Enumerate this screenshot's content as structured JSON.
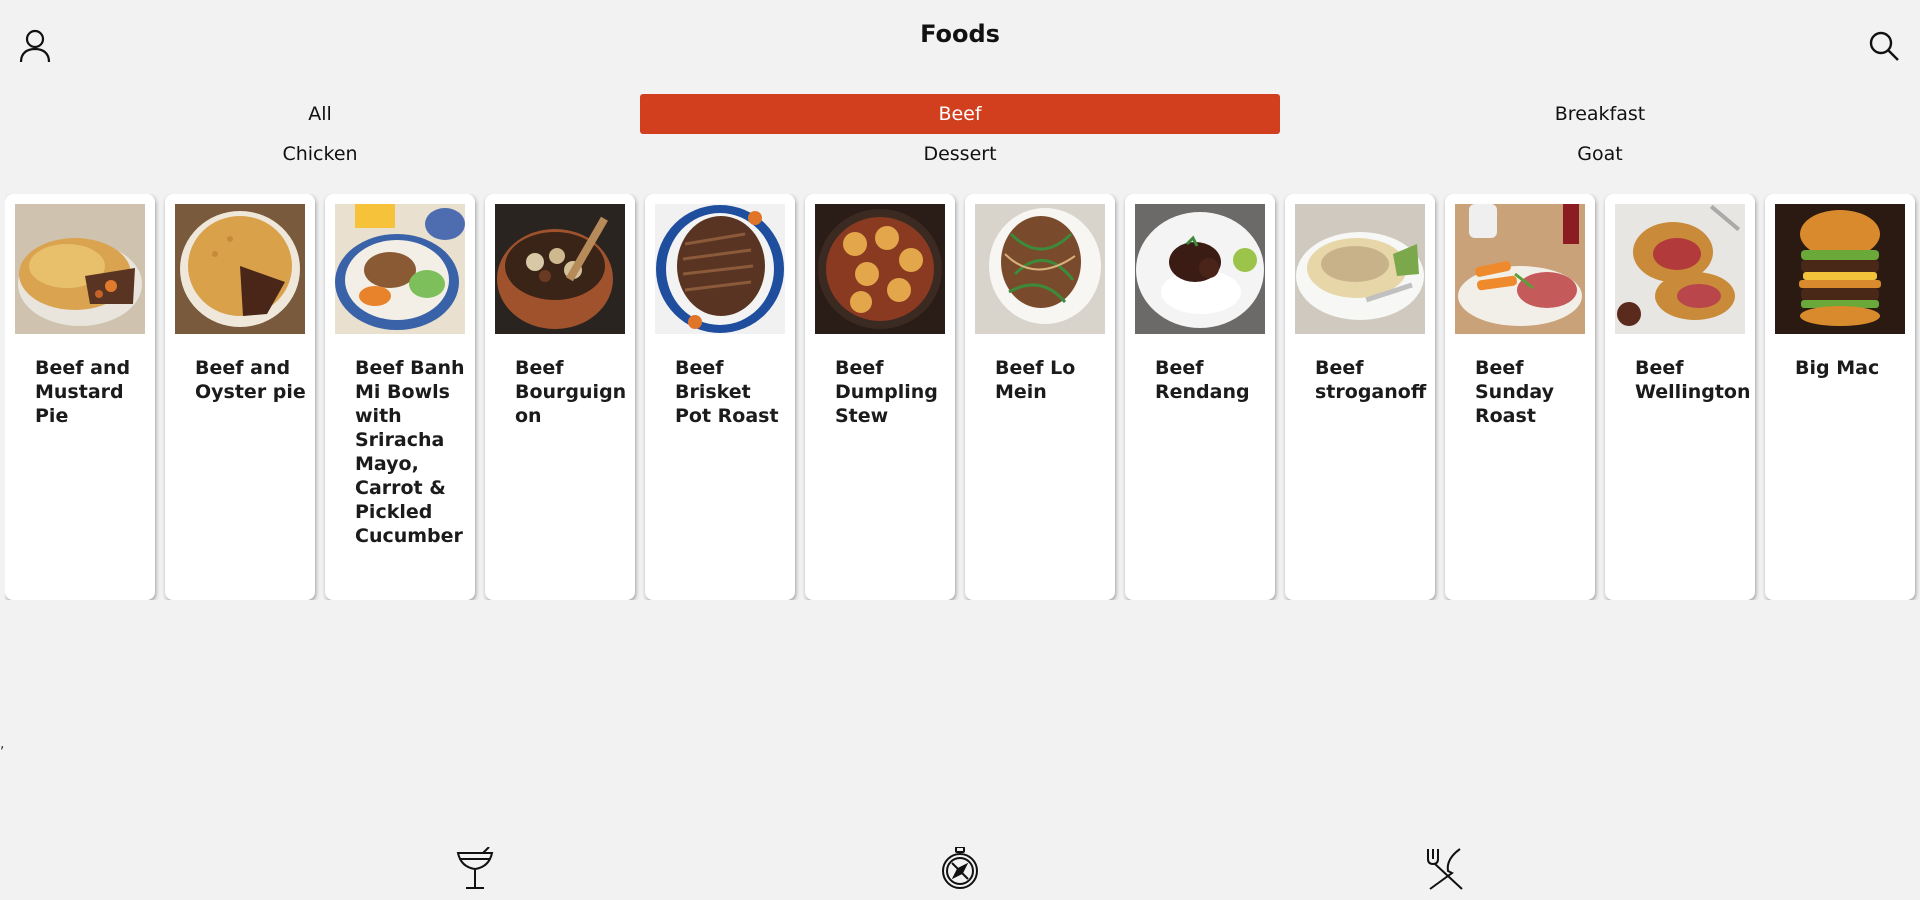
{
  "header": {
    "title": "Foods",
    "profile_icon": "user-icon",
    "search_icon": "search-icon"
  },
  "tabs": [
    {
      "label": "All",
      "active": false
    },
    {
      "label": "Beef",
      "active": true
    },
    {
      "label": "Breakfast",
      "active": false
    },
    {
      "label": "Chicken",
      "active": false
    },
    {
      "label": "Dessert",
      "active": false
    },
    {
      "label": "Goat",
      "active": false
    }
  ],
  "colors": {
    "accent": "#d13f1f",
    "background": "#f2f2f2",
    "card": "#ffffff"
  },
  "cards": [
    {
      "name": "Beef and Mustard Pie",
      "image": "beef-and-mustard-pie-photo"
    },
    {
      "name": "Beef and Oyster pie",
      "image": "beef-and-oyster-pie-photo"
    },
    {
      "name": "Beef Banh Mi Bowls with Sriracha Mayo, Carrot & Pickled Cucumber",
      "image": "beef-banh-mi-bowls-photo"
    },
    {
      "name": "Beef Bourguignon",
      "image": "beef-bourguignon-photo"
    },
    {
      "name": "Beef Brisket Pot Roast",
      "image": "beef-brisket-pot-roast-photo"
    },
    {
      "name": "Beef Dumpling Stew",
      "image": "beef-dumpling-stew-photo"
    },
    {
      "name": "Beef Lo Mein",
      "image": "beef-lo-mein-photo"
    },
    {
      "name": "Beef Rendang",
      "image": "beef-rendang-photo"
    },
    {
      "name": "Beef stroganoff",
      "image": "beef-stroganoff-photo"
    },
    {
      "name": "Beef Sunday Roast",
      "image": "beef-sunday-roast-photo"
    },
    {
      "name": "Beef Wellington",
      "image": "beef-wellington-photo"
    },
    {
      "name": "Big Mac",
      "image": "big-mac-photo"
    }
  ],
  "stray_text": ",",
  "bottom_nav": [
    {
      "name": "drinks",
      "icon": "cocktail-glass-icon"
    },
    {
      "name": "explore",
      "icon": "compass-icon"
    },
    {
      "name": "foods",
      "icon": "fork-knife-icon"
    }
  ]
}
